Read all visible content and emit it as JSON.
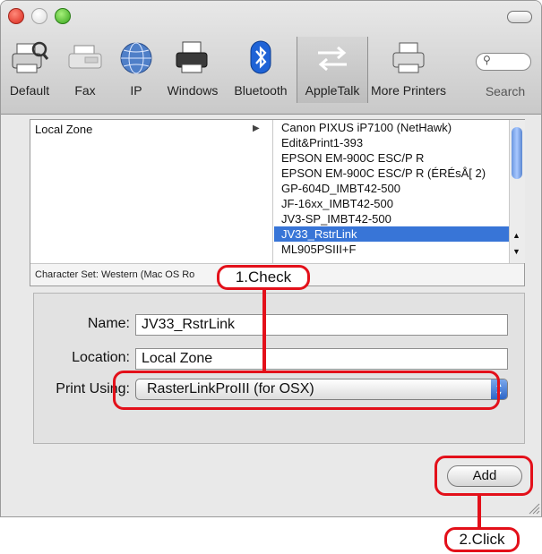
{
  "toolbar": {
    "items": [
      {
        "label": "Default",
        "icon": "default-printer-icon"
      },
      {
        "label": "Fax",
        "icon": "fax-icon"
      },
      {
        "label": "IP",
        "icon": "globe-icon"
      },
      {
        "label": "Windows",
        "icon": "windows-printer-icon"
      },
      {
        "label": "Bluetooth",
        "icon": "bluetooth-icon"
      },
      {
        "label": "AppleTalk",
        "icon": "appletalk-icon",
        "selected": true
      },
      {
        "label": "More Printers",
        "icon": "printer-icon"
      }
    ],
    "search_label": "Search"
  },
  "browser": {
    "zone": "Local Zone",
    "printers": [
      "Canon PIXUS iP7100 (NetHawk)",
      "Edit&Print1-393",
      "EPSON EM-900C ESC/P R",
      "EPSON EM-900C ESC/P R (ÉRÉsÅ[ 2)",
      "GP-604D_IMBT42-500",
      "JF-16xx_IMBT42-500",
      "JV3-SP_IMBT42-500",
      "JV33_RstrLink",
      "ML905PSIII+F"
    ],
    "selected_printer": "JV33_RstrLink",
    "charset": "Character Set:  Western (Mac OS Ro"
  },
  "form": {
    "name_label": "Name:",
    "name_value": "JV33_RstrLink",
    "location_label": "Location:",
    "location_value": "Local Zone",
    "print_using_label": "Print Using:",
    "print_using_value": "RasterLinkProIII (for OSX)"
  },
  "add_label": "Add",
  "annotations": {
    "check": "1.Check",
    "click": "2.Click",
    "color": "#e3101a"
  }
}
